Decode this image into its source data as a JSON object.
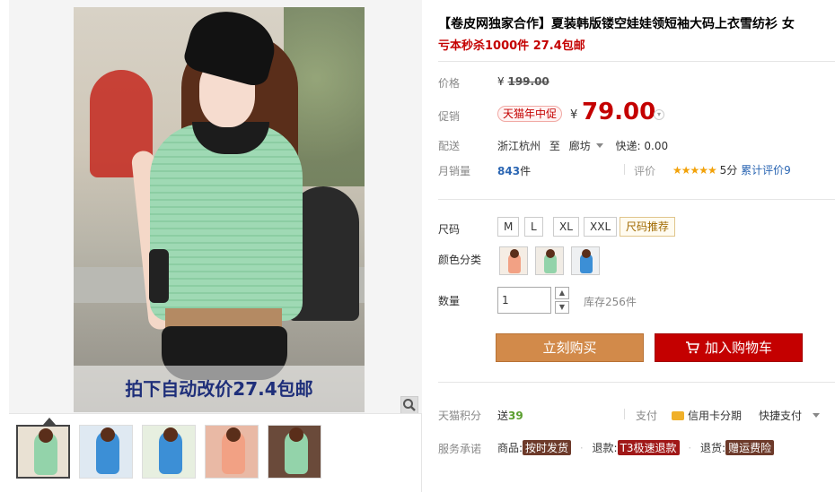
{
  "product": {
    "title": "【卷皮网独家合作】夏装韩版镂空娃娃领短袖大码上衣雪纺衫 女",
    "subtitle": "亏本秒杀1000件 27.4包邮",
    "promo_banner": "拍下自动改价27.4包邮"
  },
  "thumbnails": [
    {
      "colors": {
        "bg": "#e9e1d3",
        "fig": "#93d3aa"
      }
    },
    {
      "colors": {
        "bg": "#dfe9f2",
        "fig": "#3c8fd6"
      }
    },
    {
      "colors": {
        "bg": "#e7efe0",
        "fig": "#3c8fd6"
      }
    },
    {
      "colors": {
        "bg": "#e9b9a5",
        "fig": "#f2a184"
      }
    },
    {
      "colors": {
        "bg": "#6a4a3a",
        "fig": "#93d3aa"
      }
    }
  ],
  "price": {
    "list_label": "价格",
    "list_currency": "¥",
    "list_value": "199.00",
    "promo_label": "促销",
    "promo_badge": "天猫年中促",
    "promo_currency": "¥",
    "promo_value": "79.00"
  },
  "shipping": {
    "label": "配送",
    "from": "浙江杭州",
    "to_word": "至",
    "to": "廊坊",
    "express": "快递: 0.00"
  },
  "sales": {
    "label": "月销量",
    "value": "843",
    "unit": "件",
    "rating_label": "评价",
    "stars": "★★★★★",
    "score": "5分",
    "review_link": "累计评价9"
  },
  "options": {
    "size_label": "尺码",
    "sizes": [
      "M",
      "L",
      "XL",
      "XXL"
    ],
    "size_recommend": "尺码推荐",
    "color_label": "颜色分类",
    "colors": [
      {
        "fig": "#f2a184",
        "bg": "#f5ede4"
      },
      {
        "fig": "#93d3aa",
        "bg": "#f1ece5"
      },
      {
        "fig": "#3c8fd6",
        "bg": "#eef0f2"
      }
    ],
    "qty_label": "数量",
    "qty_value": "1",
    "stock": "库存256件"
  },
  "actions": {
    "buy_now": "立刻购买",
    "add_cart": "加入购物车"
  },
  "footer": {
    "points_label": "天猫积分",
    "points_prefix": "送",
    "points_value": "39",
    "pay_label": "支付",
    "credit": "信用卡分期",
    "quick_pay": "快捷支付",
    "promise_label": "服务承诺",
    "goods_prefix": "商品:",
    "goods_tag": "按时发货",
    "refund_prefix": "退款:",
    "refund_tag": "T3极速退款",
    "return_prefix": "退货:",
    "return_tag": "赠运费险"
  },
  "icons": [
    "zoom-icon",
    "cart-icon",
    "credit-card-icon",
    "chevron-down-icon"
  ]
}
